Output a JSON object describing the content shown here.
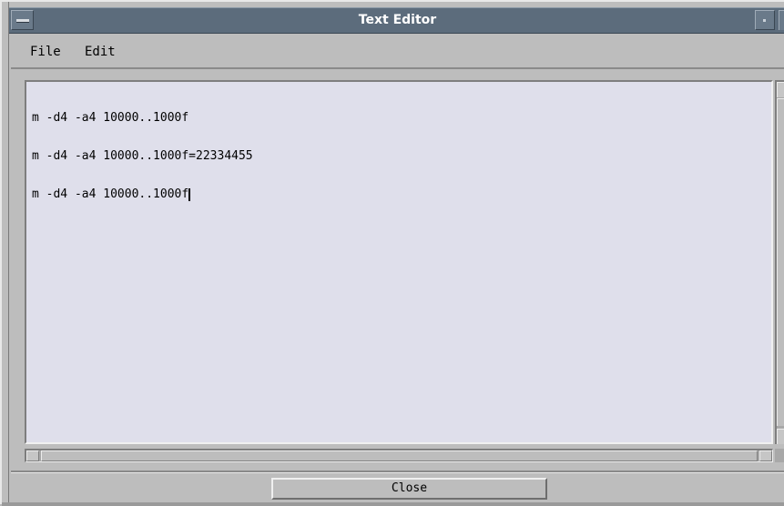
{
  "window": {
    "title": "Text Editor"
  },
  "menubar": {
    "items": [
      {
        "label": "File"
      },
      {
        "label": "Edit"
      }
    ]
  },
  "editor": {
    "lines": [
      "m -d4 -a4 10000..1000f",
      "m -d4 -a4 10000..1000f=22334455",
      "m -d4 -a4 10000..1000f"
    ]
  },
  "footer": {
    "close_label": "Close"
  },
  "icons": {
    "window_menu": "window-menu-icon",
    "minimize": "minimize-icon",
    "maximize": "maximize-icon"
  },
  "colors": {
    "titlebar": "#5c6c7c",
    "title_text": "#ffffff",
    "editor_bg": "#dfdfeb",
    "chrome": "#bdbdbd"
  }
}
